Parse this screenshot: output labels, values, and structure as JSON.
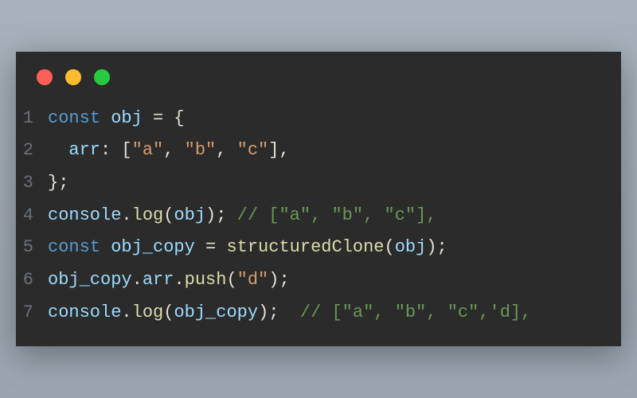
{
  "window": {
    "dots": {
      "red": "#ff5f56",
      "yellow": "#ffbd2e",
      "green": "#27c93f"
    }
  },
  "code": {
    "lines": [
      {
        "n": "1",
        "tokens": [
          {
            "cls": "tk-keyword",
            "t": "const"
          },
          {
            "cls": "tk-punct",
            "t": " "
          },
          {
            "cls": "tk-ident",
            "t": "obj"
          },
          {
            "cls": "tk-punct",
            "t": " = {"
          }
        ]
      },
      {
        "n": "2",
        "tokens": [
          {
            "cls": "tk-punct",
            "t": "  "
          },
          {
            "cls": "tk-prop",
            "t": "arr"
          },
          {
            "cls": "tk-punct",
            "t": ": ["
          },
          {
            "cls": "tk-string",
            "t": "\"a\""
          },
          {
            "cls": "tk-punct",
            "t": ", "
          },
          {
            "cls": "tk-string",
            "t": "\"b\""
          },
          {
            "cls": "tk-punct",
            "t": ", "
          },
          {
            "cls": "tk-string",
            "t": "\"c\""
          },
          {
            "cls": "tk-punct",
            "t": "],"
          }
        ]
      },
      {
        "n": "3",
        "tokens": [
          {
            "cls": "tk-punct",
            "t": "};"
          }
        ]
      },
      {
        "n": "4",
        "tokens": [
          {
            "cls": "tk-ident",
            "t": "console"
          },
          {
            "cls": "tk-punct",
            "t": "."
          },
          {
            "cls": "tk-func",
            "t": "log"
          },
          {
            "cls": "tk-punct",
            "t": "("
          },
          {
            "cls": "tk-ident",
            "t": "obj"
          },
          {
            "cls": "tk-punct",
            "t": "); "
          },
          {
            "cls": "tk-comment",
            "t": "// [\"a\", \"b\", \"c\"],"
          }
        ]
      },
      {
        "n": "5",
        "tokens": [
          {
            "cls": "tk-keyword",
            "t": "const"
          },
          {
            "cls": "tk-punct",
            "t": " "
          },
          {
            "cls": "tk-ident",
            "t": "obj_copy"
          },
          {
            "cls": "tk-punct",
            "t": " = "
          },
          {
            "cls": "tk-func",
            "t": "structuredClone"
          },
          {
            "cls": "tk-punct",
            "t": "("
          },
          {
            "cls": "tk-ident",
            "t": "obj"
          },
          {
            "cls": "tk-punct",
            "t": ");"
          }
        ]
      },
      {
        "n": "6",
        "tokens": [
          {
            "cls": "tk-ident",
            "t": "obj_copy"
          },
          {
            "cls": "tk-punct",
            "t": "."
          },
          {
            "cls": "tk-prop",
            "t": "arr"
          },
          {
            "cls": "tk-punct",
            "t": "."
          },
          {
            "cls": "tk-func",
            "t": "push"
          },
          {
            "cls": "tk-punct",
            "t": "("
          },
          {
            "cls": "tk-string",
            "t": "\"d\""
          },
          {
            "cls": "tk-punct",
            "t": ");"
          }
        ]
      },
      {
        "n": "7",
        "tokens": [
          {
            "cls": "tk-ident",
            "t": "console"
          },
          {
            "cls": "tk-punct",
            "t": "."
          },
          {
            "cls": "tk-func",
            "t": "log"
          },
          {
            "cls": "tk-punct",
            "t": "("
          },
          {
            "cls": "tk-ident",
            "t": "obj_copy"
          },
          {
            "cls": "tk-punct",
            "t": ");  "
          },
          {
            "cls": "tk-comment",
            "t": "// [\"a\", \"b\", \"c\",'d],"
          }
        ]
      }
    ]
  }
}
